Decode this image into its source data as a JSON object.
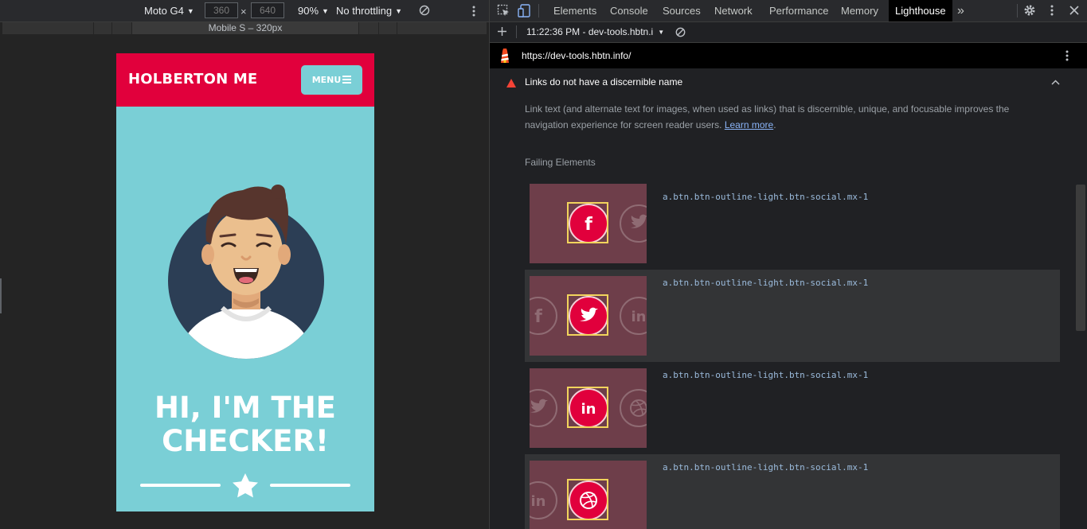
{
  "device_toolbar": {
    "device": "Moto G4",
    "width": "360",
    "times": "×",
    "height": "640",
    "zoom": "90%",
    "throttling": "No throttling",
    "breakpoint_label": "Mobile S – 320px"
  },
  "site": {
    "brand": "HOLBERTON ME",
    "menu_label": "MENU",
    "headline_line1": "HI, I'M THE",
    "headline_line2": "CHECKER!",
    "colors": {
      "nav": "#e1003c",
      "hero": "#7acfd6"
    }
  },
  "devtools": {
    "tabs": [
      "Elements",
      "Console",
      "Sources",
      "Network",
      "Performance",
      "Memory",
      "Lighthouse"
    ],
    "active_tab": "Lighthouse",
    "more": "»",
    "report_select": "11:22:36 PM - dev-tools.hbtn.i",
    "url": "https://dev-tools.hbtn.info/",
    "audit": {
      "title": "Links do not have a discernible name",
      "description": "Link text (and alternate text for images, when used as links) that is discernible, unique, and focusable improves the navigation experience for screen reader users.",
      "learn_more": "Learn more",
      "period": ".",
      "failing_label": "Failing Elements",
      "items": [
        {
          "selector": "a.btn.btn-outline-light.btn-social.mx-1",
          "icon": "facebook-icon"
        },
        {
          "selector": "a.btn.btn-outline-light.btn-social.mx-1",
          "icon": "twitter-icon"
        },
        {
          "selector": "a.btn.btn-outline-light.btn-social.mx-1",
          "icon": "linkedin-icon"
        },
        {
          "selector": "a.btn.btn-outline-light.btn-social.mx-1",
          "icon": "dribbble-icon"
        }
      ]
    }
  }
}
